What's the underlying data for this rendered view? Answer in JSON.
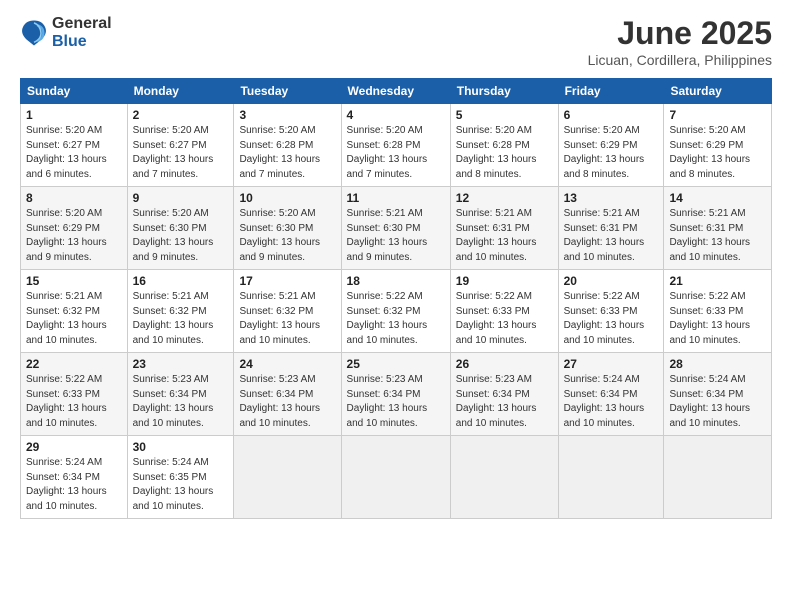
{
  "logo": {
    "line1": "General",
    "line2": "Blue"
  },
  "title": "June 2025",
  "location": "Licuan, Cordillera, Philippines",
  "header_days": [
    "Sunday",
    "Monday",
    "Tuesday",
    "Wednesday",
    "Thursday",
    "Friday",
    "Saturday"
  ],
  "weeks": [
    [
      {
        "day": "1",
        "sunrise": "5:20 AM",
        "sunset": "6:27 PM",
        "daylight": "13 hours and 6 minutes."
      },
      {
        "day": "2",
        "sunrise": "5:20 AM",
        "sunset": "6:27 PM",
        "daylight": "13 hours and 7 minutes."
      },
      {
        "day": "3",
        "sunrise": "5:20 AM",
        "sunset": "6:28 PM",
        "daylight": "13 hours and 7 minutes."
      },
      {
        "day": "4",
        "sunrise": "5:20 AM",
        "sunset": "6:28 PM",
        "daylight": "13 hours and 7 minutes."
      },
      {
        "day": "5",
        "sunrise": "5:20 AM",
        "sunset": "6:28 PM",
        "daylight": "13 hours and 8 minutes."
      },
      {
        "day": "6",
        "sunrise": "5:20 AM",
        "sunset": "6:29 PM",
        "daylight": "13 hours and 8 minutes."
      },
      {
        "day": "7",
        "sunrise": "5:20 AM",
        "sunset": "6:29 PM",
        "daylight": "13 hours and 8 minutes."
      }
    ],
    [
      {
        "day": "8",
        "sunrise": "5:20 AM",
        "sunset": "6:29 PM",
        "daylight": "13 hours and 9 minutes."
      },
      {
        "day": "9",
        "sunrise": "5:20 AM",
        "sunset": "6:30 PM",
        "daylight": "13 hours and 9 minutes."
      },
      {
        "day": "10",
        "sunrise": "5:20 AM",
        "sunset": "6:30 PM",
        "daylight": "13 hours and 9 minutes."
      },
      {
        "day": "11",
        "sunrise": "5:21 AM",
        "sunset": "6:30 PM",
        "daylight": "13 hours and 9 minutes."
      },
      {
        "day": "12",
        "sunrise": "5:21 AM",
        "sunset": "6:31 PM",
        "daylight": "13 hours and 10 minutes."
      },
      {
        "day": "13",
        "sunrise": "5:21 AM",
        "sunset": "6:31 PM",
        "daylight": "13 hours and 10 minutes."
      },
      {
        "day": "14",
        "sunrise": "5:21 AM",
        "sunset": "6:31 PM",
        "daylight": "13 hours and 10 minutes."
      }
    ],
    [
      {
        "day": "15",
        "sunrise": "5:21 AM",
        "sunset": "6:32 PM",
        "daylight": "13 hours and 10 minutes."
      },
      {
        "day": "16",
        "sunrise": "5:21 AM",
        "sunset": "6:32 PM",
        "daylight": "13 hours and 10 minutes."
      },
      {
        "day": "17",
        "sunrise": "5:21 AM",
        "sunset": "6:32 PM",
        "daylight": "13 hours and 10 minutes."
      },
      {
        "day": "18",
        "sunrise": "5:22 AM",
        "sunset": "6:32 PM",
        "daylight": "13 hours and 10 minutes."
      },
      {
        "day": "19",
        "sunrise": "5:22 AM",
        "sunset": "6:33 PM",
        "daylight": "13 hours and 10 minutes."
      },
      {
        "day": "20",
        "sunrise": "5:22 AM",
        "sunset": "6:33 PM",
        "daylight": "13 hours and 10 minutes."
      },
      {
        "day": "21",
        "sunrise": "5:22 AM",
        "sunset": "6:33 PM",
        "daylight": "13 hours and 10 minutes."
      }
    ],
    [
      {
        "day": "22",
        "sunrise": "5:22 AM",
        "sunset": "6:33 PM",
        "daylight": "13 hours and 10 minutes."
      },
      {
        "day": "23",
        "sunrise": "5:23 AM",
        "sunset": "6:34 PM",
        "daylight": "13 hours and 10 minutes."
      },
      {
        "day": "24",
        "sunrise": "5:23 AM",
        "sunset": "6:34 PM",
        "daylight": "13 hours and 10 minutes."
      },
      {
        "day": "25",
        "sunrise": "5:23 AM",
        "sunset": "6:34 PM",
        "daylight": "13 hours and 10 minutes."
      },
      {
        "day": "26",
        "sunrise": "5:23 AM",
        "sunset": "6:34 PM",
        "daylight": "13 hours and 10 minutes."
      },
      {
        "day": "27",
        "sunrise": "5:24 AM",
        "sunset": "6:34 PM",
        "daylight": "13 hours and 10 minutes."
      },
      {
        "day": "28",
        "sunrise": "5:24 AM",
        "sunset": "6:34 PM",
        "daylight": "13 hours and 10 minutes."
      }
    ],
    [
      {
        "day": "29",
        "sunrise": "5:24 AM",
        "sunset": "6:34 PM",
        "daylight": "13 hours and 10 minutes."
      },
      {
        "day": "30",
        "sunrise": "5:24 AM",
        "sunset": "6:35 PM",
        "daylight": "13 hours and 10 minutes."
      },
      null,
      null,
      null,
      null,
      null
    ]
  ],
  "labels": {
    "sunrise": "Sunrise:",
    "sunset": "Sunset:",
    "daylight": "Daylight:"
  }
}
